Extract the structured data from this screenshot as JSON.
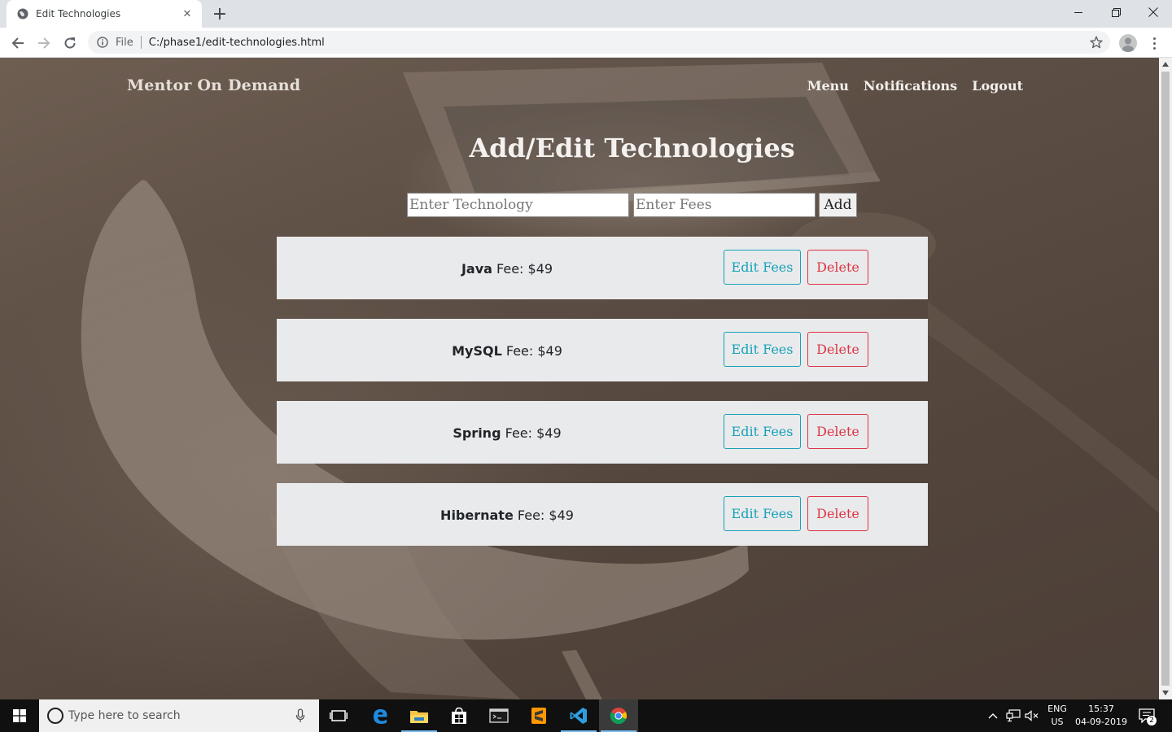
{
  "browser": {
    "tab_title": "Edit Technologies",
    "tab_close": "✕",
    "new_tab": "+",
    "scheme_label": "File",
    "url": "C:/phase1/edit-technologies.html"
  },
  "header": {
    "brand": "Mentor On Demand",
    "nav": [
      "Menu",
      "Notifications",
      "Logout"
    ]
  },
  "page": {
    "title": "Add/Edit Technologies",
    "technology_placeholder": "Enter Technology",
    "fees_placeholder": "Enter Fees",
    "add_label": "Add"
  },
  "technologies": [
    {
      "name": "Java",
      "fee_label": "Fee: $49",
      "edit_label": "Edit Fees",
      "delete_label": "Delete"
    },
    {
      "name": "MySQL",
      "fee_label": "Fee: $49",
      "edit_label": "Edit Fees",
      "delete_label": "Delete"
    },
    {
      "name": "Spring",
      "fee_label": "Fee: $49",
      "edit_label": "Edit Fees",
      "delete_label": "Delete"
    },
    {
      "name": "Hibernate",
      "fee_label": "Fee: $49",
      "edit_label": "Edit Fees",
      "delete_label": "Delete"
    }
  ],
  "taskbar": {
    "search_placeholder": "Type here to search",
    "lang_line1": "ENG",
    "lang_line2": "US",
    "time": "15:37",
    "date": "04-09-2019",
    "notification_count": "2"
  },
  "colors": {
    "edit_accent": "#17a2b8",
    "delete_accent": "#dc3545",
    "card_bg": "#e9eaec"
  }
}
